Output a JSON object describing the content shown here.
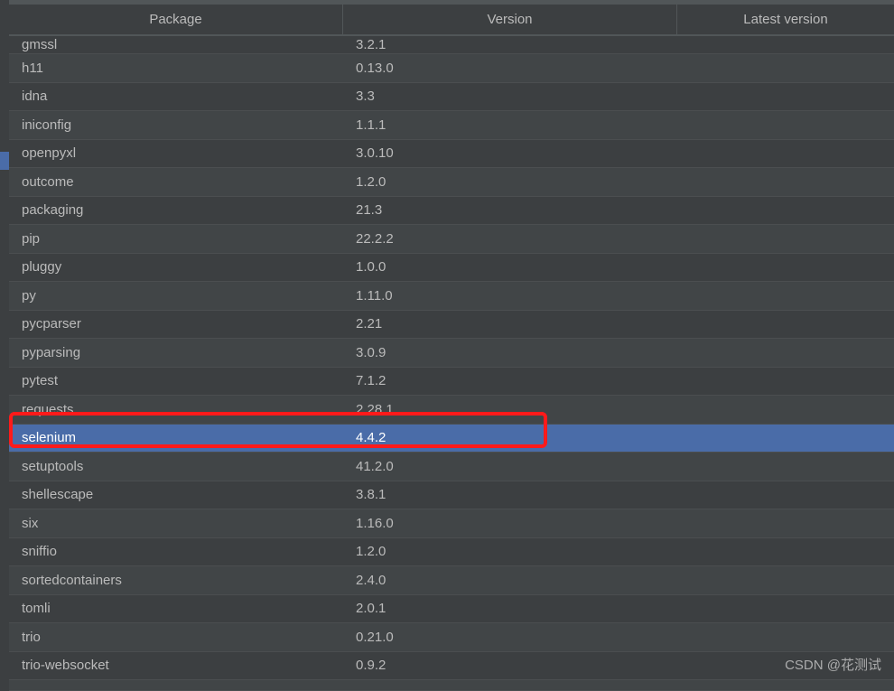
{
  "headers": {
    "package": "Package",
    "version": "Version",
    "latest": "Latest version"
  },
  "packages": [
    {
      "name": "gmssl",
      "version": "3.2.1",
      "partial": "top"
    },
    {
      "name": "h11",
      "version": "0.13.0"
    },
    {
      "name": "idna",
      "version": "3.3"
    },
    {
      "name": "iniconfig",
      "version": "1.1.1"
    },
    {
      "name": "openpyxl",
      "version": "3.0.10"
    },
    {
      "name": "outcome",
      "version": "1.2.0"
    },
    {
      "name": "packaging",
      "version": "21.3"
    },
    {
      "name": "pip",
      "version": "22.2.2"
    },
    {
      "name": "pluggy",
      "version": "1.0.0"
    },
    {
      "name": "py",
      "version": "1.11.0"
    },
    {
      "name": "pycparser",
      "version": "2.21"
    },
    {
      "name": "pyparsing",
      "version": "3.0.9"
    },
    {
      "name": "pytest",
      "version": "7.1.2"
    },
    {
      "name": "requests",
      "version": "2.28.1"
    },
    {
      "name": "selenium",
      "version": "4.4.2",
      "selected": true
    },
    {
      "name": "setuptools",
      "version": "41.2.0"
    },
    {
      "name": "shellescape",
      "version": "3.8.1"
    },
    {
      "name": "six",
      "version": "1.16.0"
    },
    {
      "name": "sniffio",
      "version": "1.2.0"
    },
    {
      "name": "sortedcontainers",
      "version": "2.4.0"
    },
    {
      "name": "tomli",
      "version": "2.0.1"
    },
    {
      "name": "trio",
      "version": "0.21.0"
    },
    {
      "name": "trio-websocket",
      "version": "0.9.2"
    },
    {
      "name": "",
      "version": "",
      "partial": "bottom"
    }
  ],
  "watermark": "CSDN @花测试"
}
